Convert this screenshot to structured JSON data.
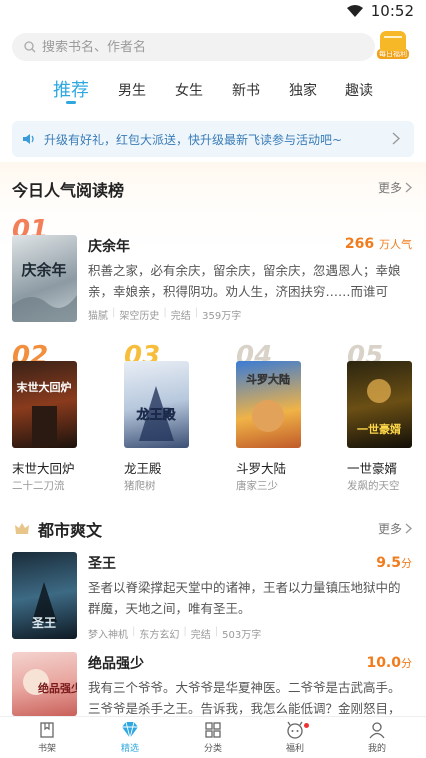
{
  "status": {
    "time": "10:52"
  },
  "search": {
    "placeholder": "搜索书名、作者名",
    "daily_label": "每日福利"
  },
  "tabs": [
    {
      "label": "推荐",
      "active": true
    },
    {
      "label": "男生"
    },
    {
      "label": "女生"
    },
    {
      "label": "新书"
    },
    {
      "label": "独家"
    },
    {
      "label": "趣读"
    }
  ],
  "notice": {
    "text": "升级有好礼，红包大派送，快升级最新飞读参与活动吧~"
  },
  "ranking": {
    "title": "今日人气阅读榜",
    "more": "更多",
    "top": {
      "rank": "01",
      "title": "庆余年",
      "heat": "266",
      "heat_unit": "万人气",
      "desc": "积善之家，必有余庆，留余庆，留余庆，忽遇恩人；幸娘亲，幸娘亲，积得阴功。劝人生，济困扶穷……而谁可知，",
      "author": "猫腻",
      "genre": "架空历史",
      "status": "完结",
      "words": "359万字",
      "cover_text": "庆余年"
    },
    "others": [
      {
        "rank": "02",
        "title": "末世大回炉",
        "author": "二十二刀流",
        "cover_text": "末世大回炉"
      },
      {
        "rank": "03",
        "title": "龙王殿",
        "author": "猪爬树",
        "cover_text": "龙王殿"
      },
      {
        "rank": "04",
        "title": "斗罗大陆",
        "author": "唐家三少",
        "cover_text": "斗罗大陆"
      },
      {
        "rank": "05",
        "title": "一世豪婿",
        "author": "发飙的天空",
        "cover_text": "一世豪婿"
      }
    ]
  },
  "urban": {
    "title": "都市爽文",
    "more": "更多",
    "books": [
      {
        "title": "圣王",
        "score": "9.5",
        "score_unit": "分",
        "desc": "圣者以脊梁撑起天堂中的诸神，王者以力量镇压地狱中的群魔，天地之间，唯有圣王。",
        "author": "梦入神机",
        "genre": "东方玄幻",
        "status": "完结",
        "words": "503万字",
        "cover_text": "圣王"
      },
      {
        "title": "绝品强少",
        "score": "10.0",
        "score_unit": "分",
        "desc": "我有三个爷爷。大爷爷是华夏神医。二爷爷是古武高手。三爷爷是杀手之王。告诉我，我怎么能低调？金刚怒目，",
        "cover_text": "绝品强少"
      }
    ]
  },
  "nav": [
    {
      "label": "书架"
    },
    {
      "label": "精选",
      "active": true
    },
    {
      "label": "分类"
    },
    {
      "label": "福利"
    },
    {
      "label": "我的"
    }
  ],
  "colors": {
    "accent": "#2fa8e0",
    "orange": "#f07c1e",
    "rank1": "#f26a3d",
    "rank2": "#f07c1e",
    "rank3": "#f6b827",
    "rank45": "#d9d2c8"
  }
}
